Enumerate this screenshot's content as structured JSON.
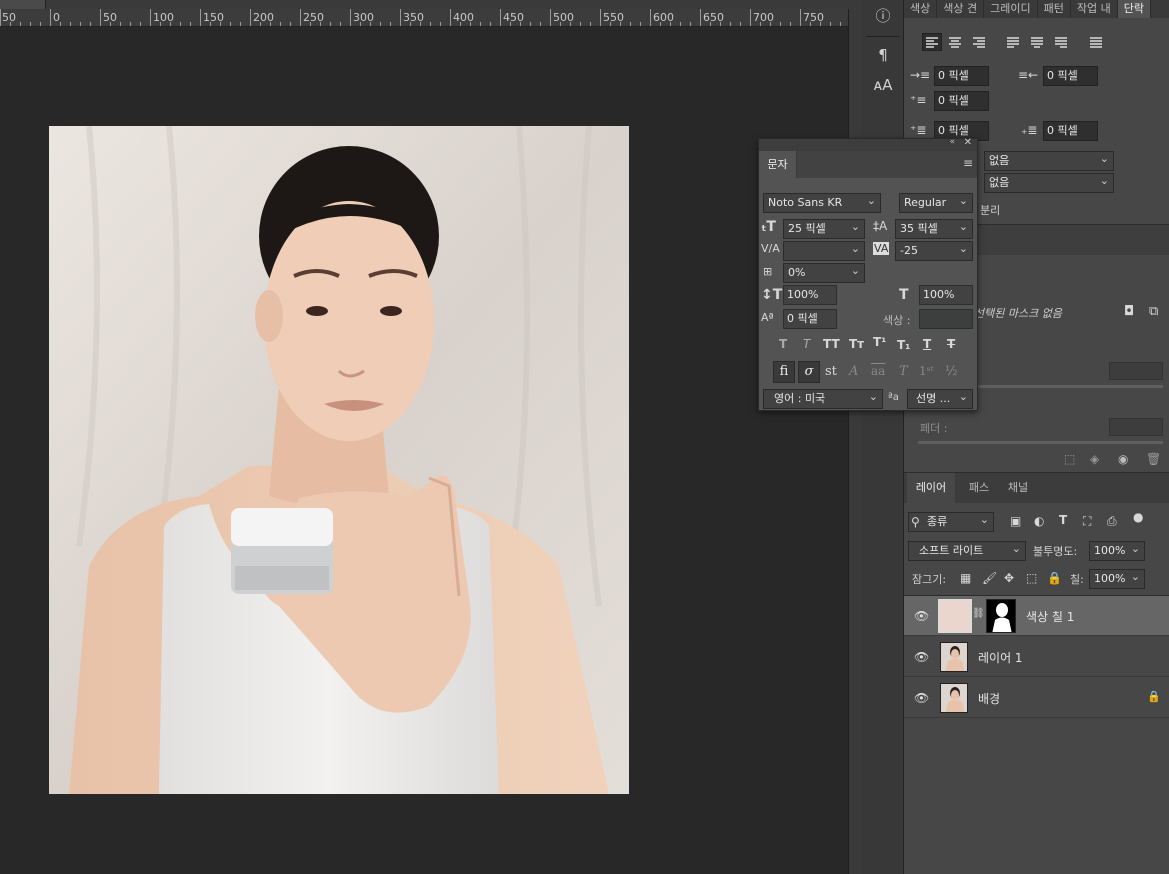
{
  "ruler": {
    "labels": [
      "50",
      "0",
      "50",
      "100",
      "150",
      "200",
      "250",
      "300",
      "350",
      "400",
      "450",
      "500",
      "550",
      "600",
      "650",
      "700",
      "750"
    ]
  },
  "canvas": {
    "image_alt": "woman holding cream jar"
  },
  "iconbar": {
    "info_icon": "info-icon",
    "paragraph_icon": "paragraph-icon",
    "character_icon": "character-icon"
  },
  "paragraph_panel": {
    "tabs": [
      "색상",
      "색상 견",
      "그레이디",
      "패턴",
      "작업 내",
      "단락"
    ],
    "active_tab": "단락",
    "indent_left": "0 픽셀",
    "indent_right": "0 픽셀",
    "indent_first": "0 픽셀",
    "space_before": "0 픽셀",
    "space_after": "0 픽셀",
    "kinsoku": "없음",
    "mojikumi": "없음",
    "hyphenate_label": "분리"
  },
  "properties_panel": {
    "mask_label": "선택된 마스크 없음",
    "feather_label": "페더 :"
  },
  "character_panel": {
    "tab": "문자",
    "font_family": "Noto Sans KR",
    "font_style": "Regular",
    "font_size": "25 픽셀",
    "leading": "35 픽셀",
    "kerning": "",
    "tracking": "-25",
    "tsume": "0%",
    "vertical_scale": "100%",
    "horizontal_scale": "100%",
    "baseline_shift": "0 픽셀",
    "color_label": "색상 :",
    "language": "영어 : 미국",
    "antialias": "선명 ...",
    "aa_label": "ªa"
  },
  "layers_panel": {
    "tabs": [
      "레이어",
      "패스",
      "채널"
    ],
    "active_tab": "레이어",
    "filter_kind": "종류",
    "blend_mode": "소프트 라이트",
    "opacity_label": "불투명도:",
    "opacity": "100%",
    "lock_label": "잠그기:",
    "fill_label": "칠:",
    "fill": "100%",
    "layers": [
      {
        "name": "색상 칠 1",
        "selected": true
      },
      {
        "name": "레이어 1",
        "selected": false
      },
      {
        "name": "배경",
        "selected": false
      }
    ]
  },
  "colors": {
    "fill_color": "#ead6cc"
  }
}
